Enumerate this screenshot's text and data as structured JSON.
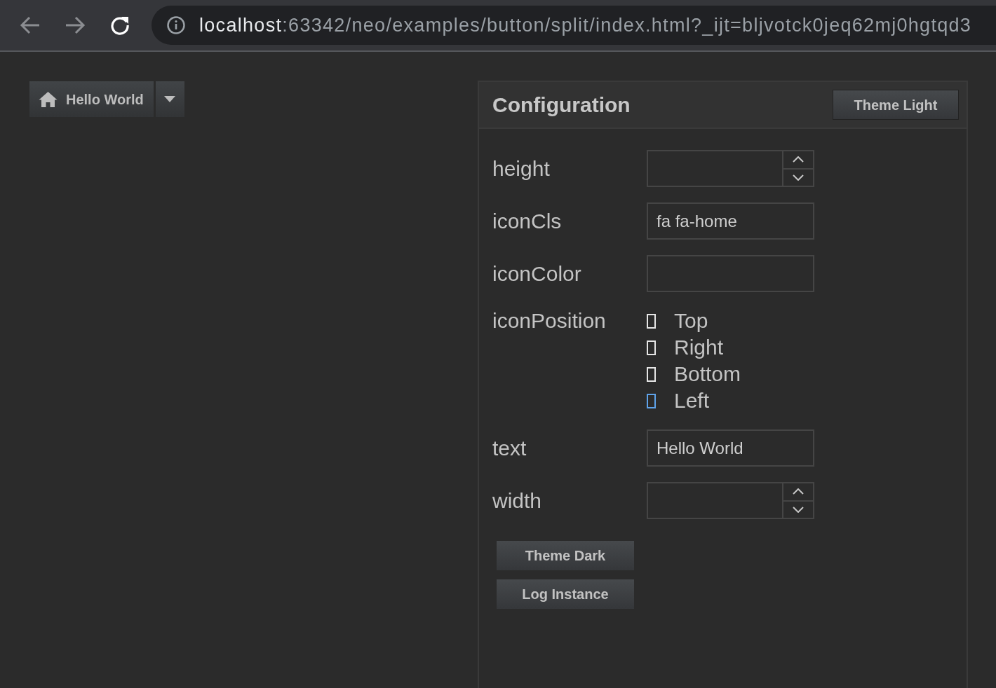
{
  "browser": {
    "url_host": "localhost",
    "url_rest": ":63342/neo/examples/button/split/index.html?_ijt=bljvotck0jeq62mj0hgtqd3"
  },
  "split_button": {
    "text": "Hello World"
  },
  "configuration": {
    "title": "Configuration",
    "header_button": "Theme Light",
    "fields": [
      {
        "kind": "number",
        "label": "height"
      },
      {
        "kind": "text",
        "label": "iconCls",
        "value": "fa fa-home"
      },
      {
        "kind": "text",
        "label": "iconColor"
      },
      {
        "kind": "radio",
        "label": "iconPosition",
        "options": [
          {
            "label": "Top",
            "selected": false
          },
          {
            "label": "Right",
            "selected": false
          },
          {
            "label": "Bottom",
            "selected": false
          },
          {
            "label": "Left",
            "selected": true
          }
        ]
      },
      {
        "kind": "text",
        "label": "text",
        "value": "Hello World"
      },
      {
        "kind": "number",
        "label": "width"
      }
    ],
    "buttons": [
      "Theme Dark",
      "Log Instance"
    ]
  }
}
